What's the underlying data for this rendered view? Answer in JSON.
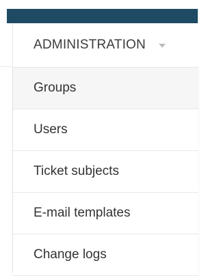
{
  "header": {
    "admin_label": "ADMINISTRATION",
    "caret_icon": "caret-down-icon"
  },
  "menu": {
    "items": [
      {
        "label": "Groups",
        "active": true
      },
      {
        "label": "Users",
        "active": false
      },
      {
        "label": "Ticket subjects",
        "active": false
      },
      {
        "label": "E-mail templates",
        "active": false
      },
      {
        "label": "Change logs",
        "active": false
      }
    ]
  },
  "colors": {
    "topbar": "#1f4a63",
    "text": "#333333",
    "active_background": "#f6f6f6",
    "caret": "#bdbdbd"
  }
}
